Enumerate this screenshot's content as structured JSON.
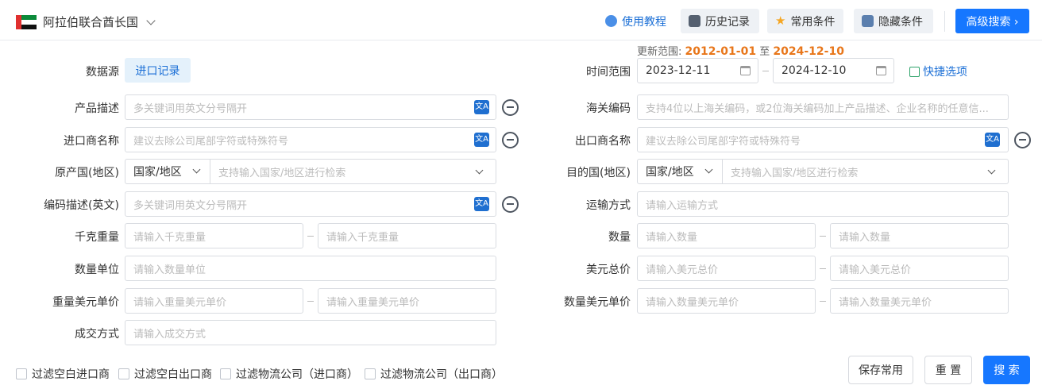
{
  "header": {
    "country": "阿拉伯联合酋长国",
    "tutorial": "使用教程",
    "history": "历史记录",
    "common": "常用条件",
    "hide": "隐藏条件",
    "advanced": "高级搜索 ›"
  },
  "range": {
    "prefix": "更新范围:",
    "start": "2012-01-01",
    "mid": "至",
    "end": "2024-12-10"
  },
  "left": {
    "datasource_label": "数据源",
    "datasource_tag": "进口记录",
    "product_label": "产品描述",
    "product_ph": "多关键词用英文分号隔开",
    "importer_label": "进口商名称",
    "importer_ph": "建议去除公司尾部字符或特殊符号",
    "origin_label": "原产国(地区)",
    "origin_select": "国家/地区",
    "origin_ph": "支持输入国家/地区进行检索",
    "code_desc_label": "编码描述(英文)",
    "code_desc_ph": "多关键词用英文分号隔开",
    "kg_label": "千克重量",
    "kg_ph": "请输入千克重量",
    "unit_label": "数量单位",
    "unit_ph": "请输入数量单位",
    "weight_price_label": "重量美元单价",
    "weight_price_ph": "请输入重量美元单价",
    "deal_label": "成交方式",
    "deal_ph": "请输入成交方式"
  },
  "right": {
    "time_label": "时间范围",
    "date_start": "2023-12-11",
    "date_end": "2024-12-10",
    "quick": "快捷选项",
    "hs_label": "海关编码",
    "hs_ph": "支持4位以上海关编码，或2位海关编码加上产品描述、企业名称的任意信...",
    "exporter_label": "出口商名称",
    "exporter_ph": "建议去除公司尾部字符或特殊符号",
    "dest_label": "目的国(地区)",
    "dest_select": "国家/地区",
    "dest_ph": "支持输入国家/地区进行检索",
    "transport_label": "运输方式",
    "transport_ph": "请输入运输方式",
    "qty_label": "数量",
    "qty_ph": "请输入数量",
    "usd_total_label": "美元总价",
    "usd_total_ph": "请输入美元总价",
    "qty_price_label": "数量美元单价",
    "qty_price_ph": "请输入数量美元单价"
  },
  "filters": [
    "过滤空白进口商",
    "过滤空白出口商",
    "过滤物流公司（进口商）",
    "过滤物流公司（出口商）"
  ],
  "actions": {
    "save": "保存常用",
    "reset": "重 置",
    "search": "搜 索"
  },
  "colors": {
    "primary": "#1677ff",
    "orange": "#e8761a",
    "link": "#1b6fd6"
  }
}
